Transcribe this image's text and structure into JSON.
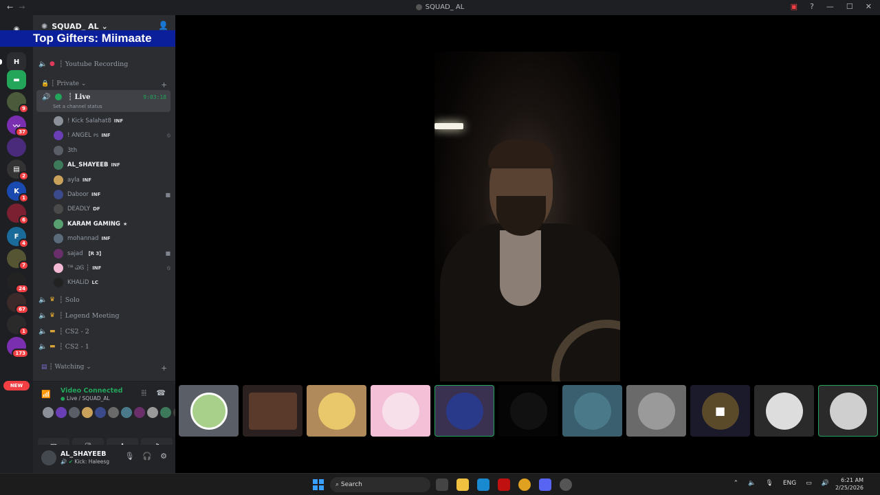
{
  "window": {
    "title": "SQUAD_ AL",
    "back": "←",
    "forward": "→"
  },
  "banner": {
    "text": "Top Gifters: Miimaate"
  },
  "servers": {
    "badges": [
      "9",
      "37",
      "2",
      "1",
      "6",
      "4",
      "7",
      "24",
      "67",
      "1",
      "173"
    ],
    "new_label": "NEW"
  },
  "server": {
    "name": "SQUAD_ AL"
  },
  "channels": {
    "youtube": "┆ Youtube Recording",
    "private_cat": "┆ Private",
    "live": {
      "name": "┆ Live",
      "time": "9:03:18",
      "status": "Set a channel status"
    },
    "users": [
      {
        "name": "! Kick Salahat8",
        "tag": "INF",
        "color": "#8a8f98"
      },
      {
        "name": "! ANGEL",
        "sub": "PS",
        "tag": "INF",
        "color": "#6a3fb6"
      },
      {
        "name": "3th",
        "tag": "",
        "color": "#5a5e66"
      },
      {
        "name": "AL_SHAYEEB",
        "tag": "INF",
        "color": "#3d7a5b",
        "bright": true
      },
      {
        "name": "ayla",
        "tag": "INF",
        "color": "#c9a15a"
      },
      {
        "name": "Daboor",
        "tag": "INF",
        "color": "#3a4a8a"
      },
      {
        "name": "DEADLY",
        "tag": "DF",
        "color": "#4a4a4a"
      },
      {
        "name": "KARAM GAMING",
        "tag": "★",
        "color": "#59a070",
        "bright": true
      },
      {
        "name": "mohannad",
        "tag": "INF",
        "color": "#5b6b7b"
      },
      {
        "name": "sajad",
        "tag": "【R 3】",
        "color": "#6a2f6a"
      },
      {
        "name": "ᵀᴵᴮ ᏊᎶ ┆",
        "tag": "INF",
        "color": "#f3b9d5"
      },
      {
        "name": "KHALiD",
        "tag": "LC",
        "color": "#222222"
      }
    ],
    "solo": "┆ Solo",
    "legend": "┆ Legend Meeting",
    "cs22": "┆ CS2 - 2",
    "cs21": "┆ CS2 - 1",
    "watching_cat": "┆ Watching"
  },
  "voice": {
    "status": "Video Connected",
    "channel": "Live / SQUAD_AL"
  },
  "user": {
    "name": "AL_SHAYEEB",
    "status": "Kick: Haleesg"
  },
  "taskbar": {
    "search": "Search",
    "lang": "ENG",
    "time": "6:21 AM",
    "date": "2/25/2026"
  }
}
